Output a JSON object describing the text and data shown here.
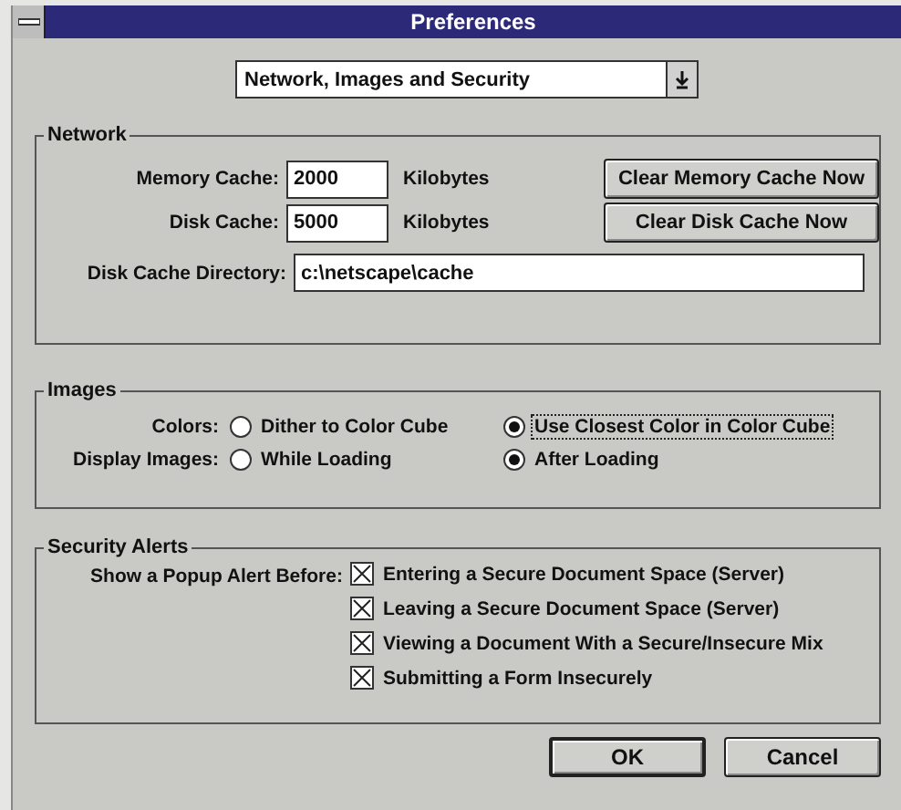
{
  "window": {
    "title": "Preferences"
  },
  "category_select": {
    "value": "Network, Images and Security"
  },
  "network": {
    "title": "Network",
    "fields": [
      {
        "kind": "size",
        "label": "Memory Cache:",
        "value": "2000",
        "unit": "Kilobytes",
        "button": "Clear Memory Cache Now"
      },
      {
        "kind": "size",
        "label": "Disk Cache:",
        "value": "5000",
        "unit": "Kilobytes",
        "button": "Clear Disk Cache Now"
      },
      {
        "kind": "path",
        "label": "Disk Cache Directory:",
        "value": "c:\\netscape\\cache"
      }
    ]
  },
  "images": {
    "title": "Images",
    "rows": [
      {
        "label": "Colors:",
        "options": [
          {
            "label": "Dither to Color Cube",
            "selected": false,
            "focused": false
          },
          {
            "label": "Use Closest Color in Color Cube",
            "selected": true,
            "focused": true
          }
        ]
      },
      {
        "label": "Display Images:",
        "options": [
          {
            "label": "While Loading",
            "selected": false,
            "focused": false
          },
          {
            "label": "After Loading",
            "selected": true,
            "focused": false
          }
        ]
      }
    ]
  },
  "security": {
    "title": "Security Alerts",
    "label": "Show a Popup Alert Before:",
    "alerts": [
      {
        "label": "Entering a Secure Document Space (Server)",
        "checked": true
      },
      {
        "label": "Leaving a Secure Document Space (Server)",
        "checked": true
      },
      {
        "label": "Viewing a Document With a Secure/Insecure Mix",
        "checked": true
      },
      {
        "label": "Submitting a Form Insecurely",
        "checked": true
      }
    ]
  },
  "buttons": [
    {
      "label": "OK",
      "default": true
    },
    {
      "label": "Cancel",
      "default": false
    }
  ]
}
